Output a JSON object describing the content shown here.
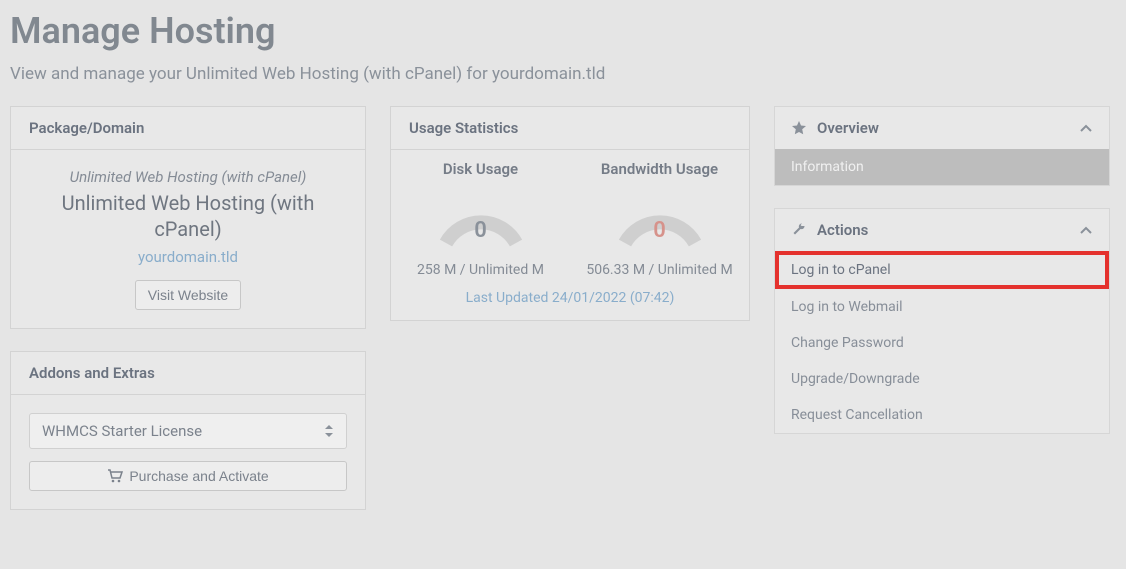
{
  "page": {
    "title": "Manage Hosting",
    "subtitle": "View and manage your Unlimited Web Hosting (with cPanel) for yourdomain.tld"
  },
  "package_card": {
    "header": "Package/Domain",
    "subline": "Unlimited Web Hosting (with cPanel)",
    "title": "Unlimited Web Hosting (with cPanel)",
    "domain": "yourdomain.tld",
    "visit_button": "Visit Website"
  },
  "usage_card": {
    "header": "Usage Statistics",
    "disk": {
      "label": "Disk Usage",
      "value": "0",
      "footer": "258 M / Unlimited M"
    },
    "bandwidth": {
      "label": "Bandwidth Usage",
      "value": "0",
      "footer": "506.33 M / Unlimited M"
    },
    "last_updated": "Last Updated 24/01/2022 (07:42)"
  },
  "addons_card": {
    "header": "Addons and Extras",
    "selected_option": "WHMCS Starter License",
    "purchase_button": "Purchase and Activate"
  },
  "overview": {
    "header": "Overview",
    "info": "Information"
  },
  "actions": {
    "header": "Actions",
    "items": [
      "Log in to cPanel",
      "Log in to Webmail",
      "Change Password",
      "Upgrade/Downgrade",
      "Request Cancellation"
    ]
  }
}
